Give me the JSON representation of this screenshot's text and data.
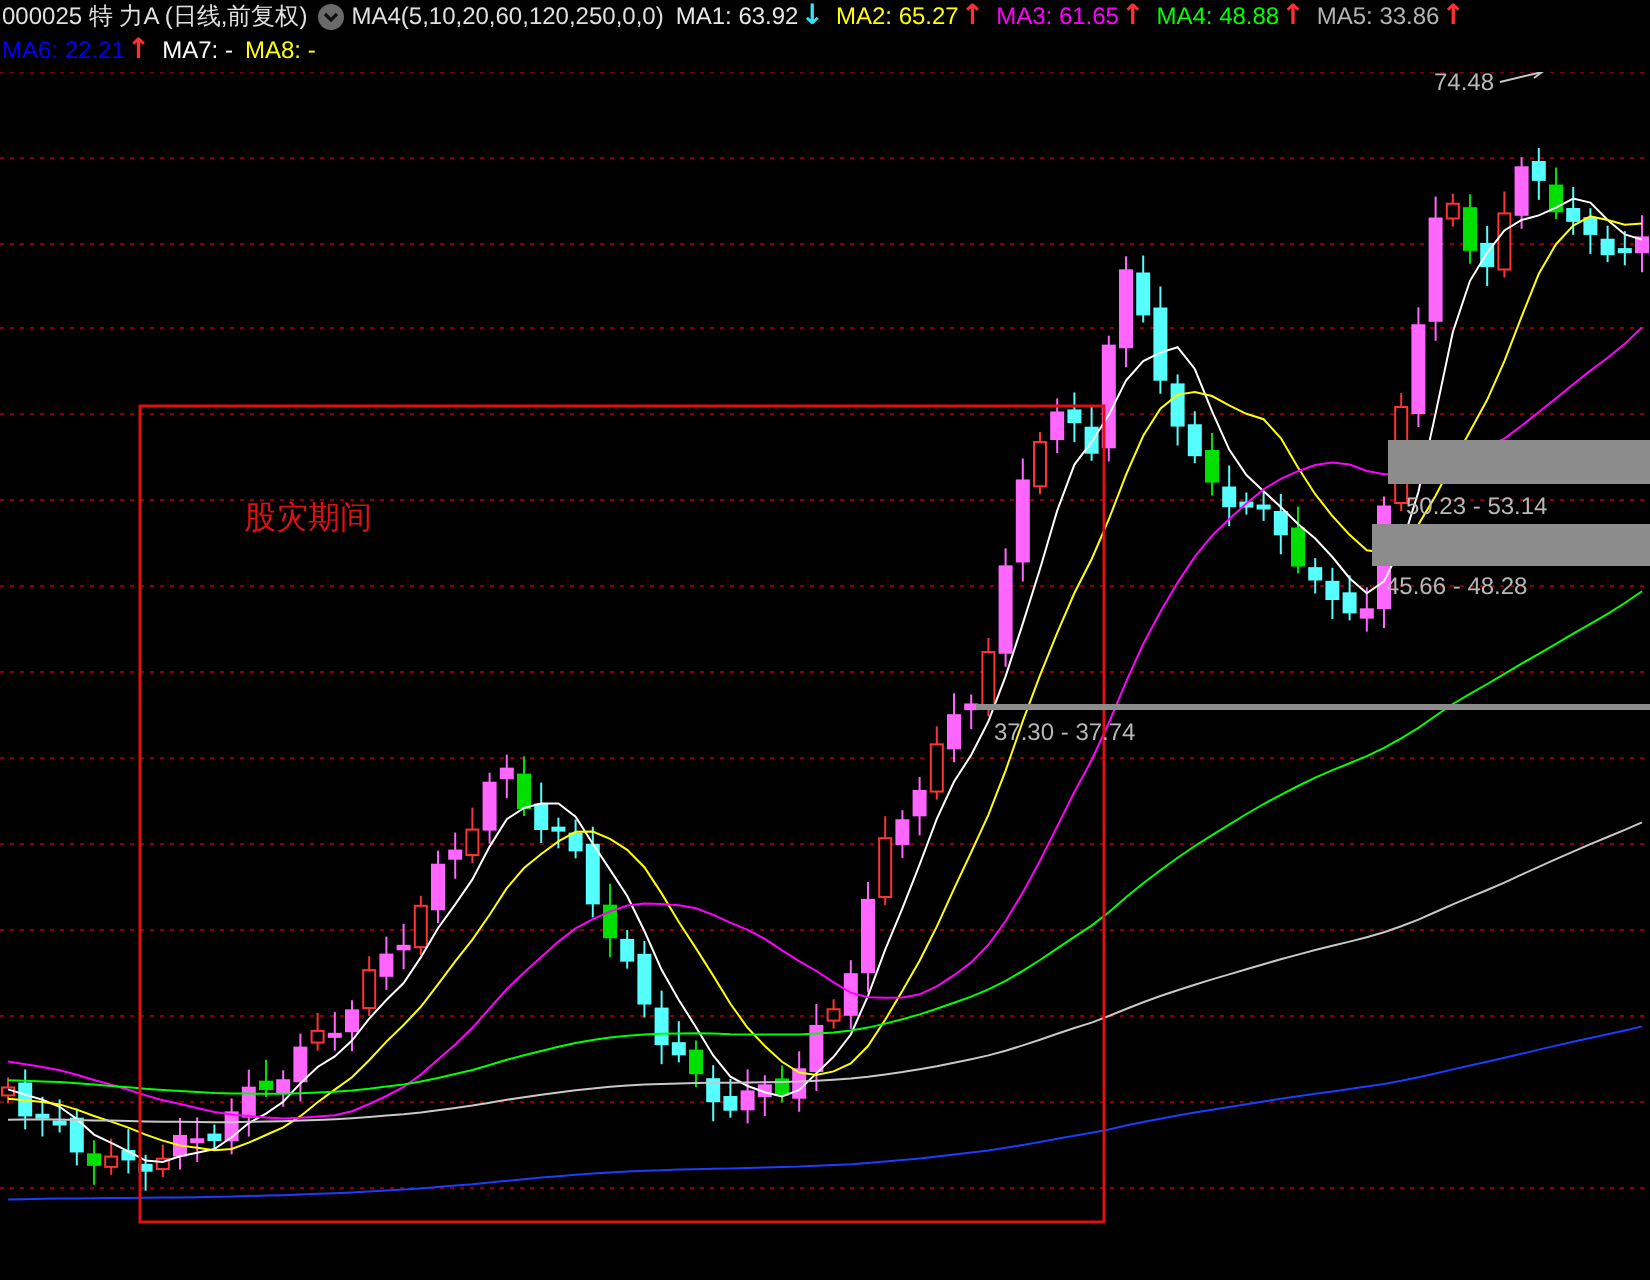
{
  "header": {
    "security": "000025 特 力A (日线,前复权)",
    "indicator": "MA4(5,10,20,60,120,250,0,0)",
    "averages": [
      {
        "label": "MA1:",
        "value": "63.92",
        "color": "#e8e8e8",
        "arrow": {
          "text": "↓",
          "color": "#30e0ff"
        }
      },
      {
        "label": "MA2:",
        "value": "65.27",
        "color": "#ffff00",
        "arrow": {
          "text": "↑",
          "color": "#ff3030"
        }
      },
      {
        "label": "MA3:",
        "value": "61.65",
        "color": "#ff00ff",
        "arrow": {
          "text": "↑",
          "color": "#ff3030"
        }
      },
      {
        "label": "MA4:",
        "value": "48.88",
        "color": "#00ff00",
        "arrow": {
          "text": "↑",
          "color": "#ff3030"
        }
      },
      {
        "label": "MA5:",
        "value": "33.86",
        "color": "#b4b4b4",
        "arrow": {
          "text": "↑",
          "color": "#ff3030"
        }
      },
      {
        "label": "MA6:",
        "value": "22.21",
        "color": "#0000ff",
        "arrow": {
          "text": "↑",
          "color": "#ff3030"
        }
      },
      {
        "label": "MA7:",
        "value": "-",
        "color": "#ffffff"
      },
      {
        "label": "MA8:",
        "value": "-",
        "color": "#ffff00"
      }
    ]
  },
  "chart": {
    "period_label": "股灾期间",
    "peak_label": "74.48",
    "gaps": [
      {
        "label": "50.23 - 53.14"
      },
      {
        "label": "45.66 - 48.28"
      },
      {
        "label": "37.30 - 37.74"
      }
    ]
  }
}
